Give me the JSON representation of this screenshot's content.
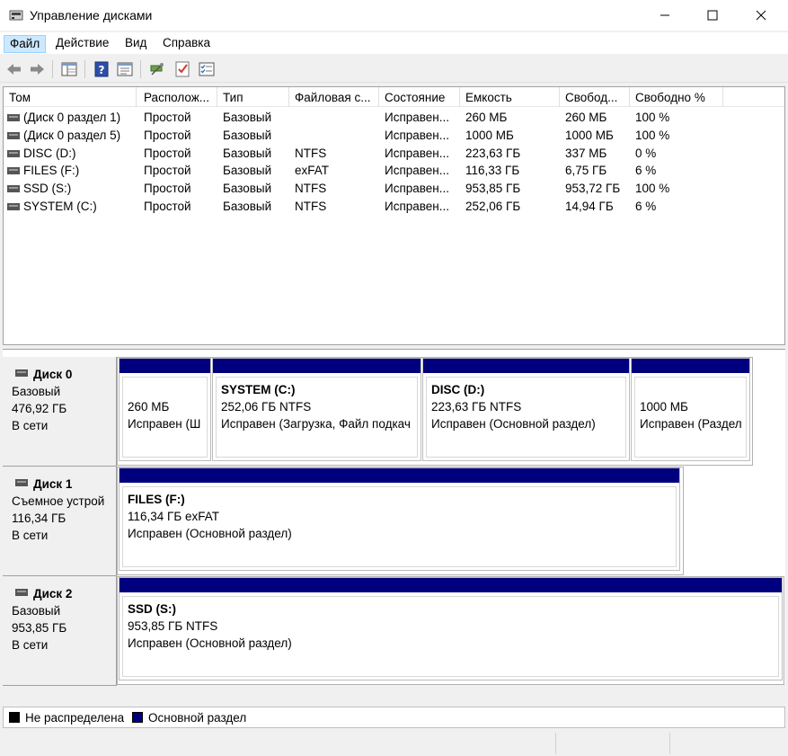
{
  "window": {
    "title": "Управление дисками"
  },
  "menu": {
    "file": "Файл",
    "action": "Действие",
    "view": "Вид",
    "help": "Справка"
  },
  "toolbar": {
    "icons": [
      "back-arrow-icon",
      "forward-arrow-icon",
      "disk-list-icon",
      "help-icon",
      "properties-icon",
      "connect-icon",
      "check-icon",
      "settings-list-icon"
    ]
  },
  "columns": [
    "Том",
    "Располож...",
    "Тип",
    "Файловая с...",
    "Состояние",
    "Емкость",
    "Свобод...",
    "Свободно %"
  ],
  "volumes": [
    {
      "name": "(Диск 0 раздел 1)",
      "layout": "Простой",
      "type": "Базовый",
      "fs": "",
      "status": "Исправен...",
      "capacity": "260 МБ",
      "free": "260 МБ",
      "free_pct": "100 %"
    },
    {
      "name": "(Диск 0 раздел 5)",
      "layout": "Простой",
      "type": "Базовый",
      "fs": "",
      "status": "Исправен...",
      "capacity": "1000 МБ",
      "free": "1000 МБ",
      "free_pct": "100 %"
    },
    {
      "name": "DISC (D:)",
      "layout": "Простой",
      "type": "Базовый",
      "fs": "NTFS",
      "status": "Исправен...",
      "capacity": "223,63 ГБ",
      "free": "337 МБ",
      "free_pct": "0 %"
    },
    {
      "name": "FILES (F:)",
      "layout": "Простой",
      "type": "Базовый",
      "fs": "exFAT",
      "status": "Исправен...",
      "capacity": "116,33 ГБ",
      "free": "6,75 ГБ",
      "free_pct": "6 %"
    },
    {
      "name": "SSD (S:)",
      "layout": "Простой",
      "type": "Базовый",
      "fs": "NTFS",
      "status": "Исправен...",
      "capacity": "953,85 ГБ",
      "free": "953,72 ГБ",
      "free_pct": "100 %"
    },
    {
      "name": "SYSTEM (C:)",
      "layout": "Простой",
      "type": "Базовый",
      "fs": "NTFS",
      "status": "Исправен...",
      "capacity": "252,06 ГБ",
      "free": "14,94 ГБ",
      "free_pct": "6 %"
    }
  ],
  "disks": [
    {
      "name": "Диск 0",
      "kind": "Базовый",
      "size": "476,92 ГБ",
      "state": "В сети",
      "partitions": [
        {
          "name": "",
          "size": "260 МБ",
          "status": "Исправен (Ш"
        },
        {
          "name": "SYSTEM  (C:)",
          "size": "252,06 ГБ NTFS",
          "status": "Исправен (Загрузка, Файл подкач"
        },
        {
          "name": "DISC  (D:)",
          "size": "223,63 ГБ NTFS",
          "status": "Исправен (Основной раздел)"
        },
        {
          "name": "",
          "size": "1000 МБ",
          "status": "Исправен (Раздел"
        }
      ]
    },
    {
      "name": "Диск 1",
      "kind": "Съемное устрой",
      "size": "116,34 ГБ",
      "state": "В сети",
      "partitions": [
        {
          "name": "FILES  (F:)",
          "size": "116,34 ГБ exFAT",
          "status": "Исправен (Основной раздел)"
        }
      ]
    },
    {
      "name": "Диск 2",
      "kind": "Базовый",
      "size": "953,85 ГБ",
      "state": "В сети",
      "partitions": [
        {
          "name": "SSD  (S:)",
          "size": "953,85 ГБ NTFS",
          "status": "Исправен (Основной раздел)"
        }
      ]
    }
  ],
  "legend": {
    "unallocated": "Не распределена",
    "primary": "Основной раздел",
    "unallocated_color": "#000000",
    "primary_color": "#00007f"
  }
}
